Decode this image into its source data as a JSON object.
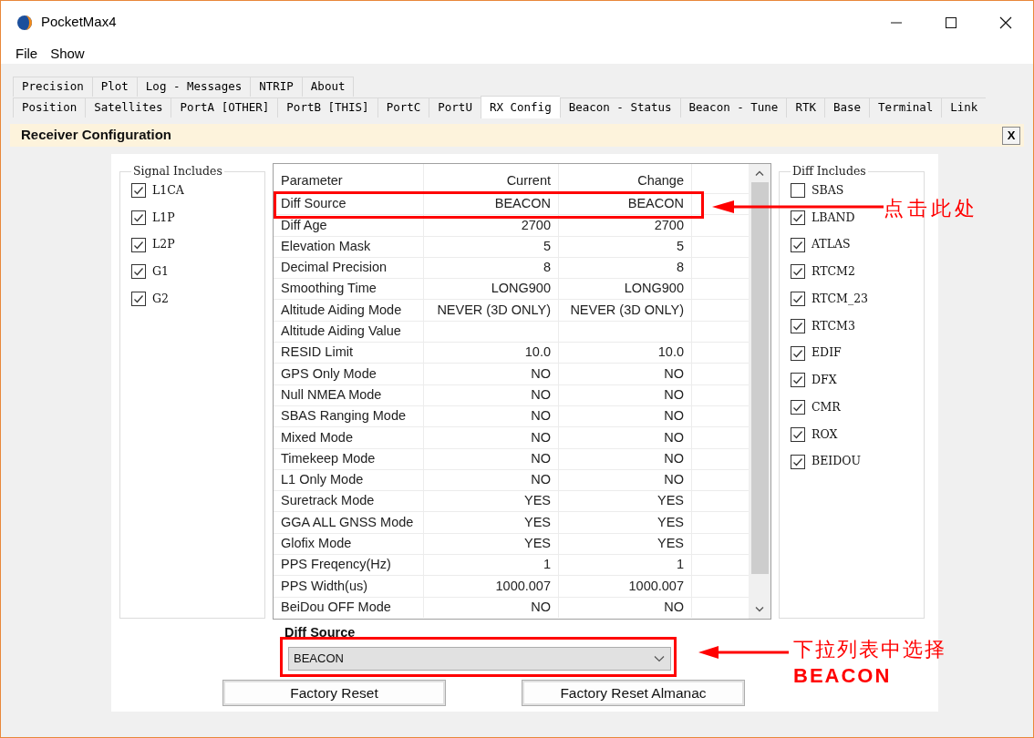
{
  "window": {
    "title": "PocketMax4"
  },
  "menu": [
    "File",
    "Show"
  ],
  "tab_rows": [
    [
      {
        "label": "Precision",
        "selected": false
      },
      {
        "label": "Plot",
        "selected": false
      },
      {
        "label": "Log - Messages",
        "selected": false
      },
      {
        "label": "NTRIP",
        "selected": false
      },
      {
        "label": "About",
        "selected": false
      }
    ],
    [
      {
        "label": "Position",
        "selected": false
      },
      {
        "label": "Satellites",
        "selected": false
      },
      {
        "label": "PortA [OTHER]",
        "selected": false
      },
      {
        "label": "PortB [THIS]",
        "selected": false
      },
      {
        "label": "PortC",
        "selected": false
      },
      {
        "label": "PortU",
        "selected": false
      },
      {
        "label": "RX Config",
        "selected": true
      },
      {
        "label": "Beacon - Status",
        "selected": false
      },
      {
        "label": "Beacon - Tune",
        "selected": false
      },
      {
        "label": "RTK",
        "selected": false
      },
      {
        "label": "Base",
        "selected": false
      },
      {
        "label": "Terminal",
        "selected": false
      },
      {
        "label": "Link",
        "selected": false
      }
    ]
  ],
  "panel": {
    "title": "Receiver Configuration",
    "close": "X"
  },
  "signal_includes": {
    "title": "Signal Includes",
    "items": [
      {
        "label": "L1CA",
        "checked": true
      },
      {
        "label": "L1P",
        "checked": true
      },
      {
        "label": "L2P",
        "checked": true
      },
      {
        "label": "G1",
        "checked": true
      },
      {
        "label": "G2",
        "checked": true
      }
    ]
  },
  "table": {
    "columns": [
      "Parameter",
      "Current",
      "Change"
    ],
    "rows": [
      [
        "Diff Source",
        "BEACON",
        "BEACON"
      ],
      [
        "Diff Age",
        "2700",
        "2700"
      ],
      [
        "Elevation Mask",
        "5",
        "5"
      ],
      [
        "Decimal Precision",
        "8",
        "8"
      ],
      [
        "Smoothing Time",
        "LONG900",
        "LONG900"
      ],
      [
        "Altitude Aiding Mode",
        "NEVER (3D ONLY)",
        "NEVER (3D ONLY)"
      ],
      [
        "Altitude Aiding Value",
        "",
        ""
      ],
      [
        "RESID Limit",
        "10.0",
        "10.0"
      ],
      [
        "GPS Only Mode",
        "NO",
        "NO"
      ],
      [
        "Null NMEA Mode",
        "NO",
        "NO"
      ],
      [
        "SBAS Ranging Mode",
        "NO",
        "NO"
      ],
      [
        "Mixed Mode",
        "NO",
        "NO"
      ],
      [
        "Timekeep Mode",
        "NO",
        "NO"
      ],
      [
        "L1 Only Mode",
        "NO",
        "NO"
      ],
      [
        "Suretrack Mode",
        "YES",
        "YES"
      ],
      [
        "GGA ALL GNSS Mode",
        "YES",
        "YES"
      ],
      [
        "Glofix Mode",
        "YES",
        "YES"
      ],
      [
        "PPS Freqency(Hz)",
        "1",
        "1"
      ],
      [
        "PPS Width(us)",
        "1000.007",
        "1000.007"
      ],
      [
        "BeiDou OFF Mode",
        "NO",
        "NO"
      ]
    ]
  },
  "diff_includes": {
    "title": "Diff Includes",
    "items": [
      {
        "label": "SBAS",
        "checked": false
      },
      {
        "label": "LBAND",
        "checked": true
      },
      {
        "label": "ATLAS",
        "checked": true
      },
      {
        "label": "RTCM2",
        "checked": true
      },
      {
        "label": "RTCM_23",
        "checked": true
      },
      {
        "label": "RTCM3",
        "checked": true
      },
      {
        "label": "EDIF",
        "checked": true
      },
      {
        "label": "DFX",
        "checked": true
      },
      {
        "label": "CMR",
        "checked": true
      },
      {
        "label": "ROX",
        "checked": true
      },
      {
        "label": "BEIDOU",
        "checked": true
      }
    ]
  },
  "diff_source": {
    "label": "Diff Source",
    "value": "BEACON"
  },
  "buttons": [
    "Factory Reset",
    "Factory Reset Almanac"
  ],
  "annotations": [
    {
      "text": "点击此处"
    },
    {
      "text": "下拉列表中选择**BEACON**"
    }
  ]
}
